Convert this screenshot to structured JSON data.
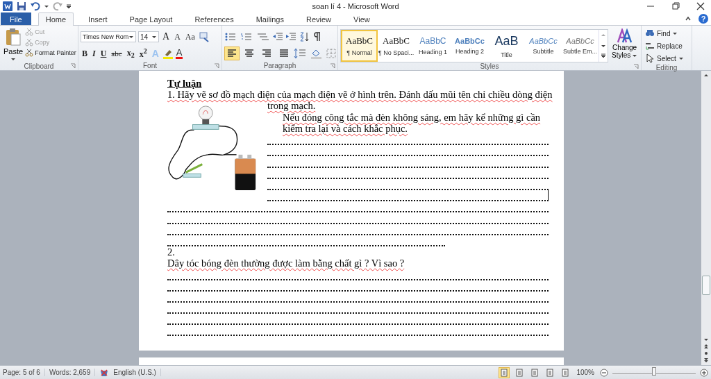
{
  "window": {
    "title": "soan lí 4 - Microsoft Word"
  },
  "tabs": [
    {
      "label": "File",
      "kind": "file",
      "selected": false
    },
    {
      "label": "Home",
      "kind": "tab",
      "selected": true
    },
    {
      "label": "Insert",
      "kind": "tab",
      "selected": false
    },
    {
      "label": "Page Layout",
      "kind": "tab",
      "selected": false
    },
    {
      "label": "References",
      "kind": "tab",
      "selected": false
    },
    {
      "label": "Mailings",
      "kind": "tab",
      "selected": false
    },
    {
      "label": "Review",
      "kind": "tab",
      "selected": false
    },
    {
      "label": "View",
      "kind": "tab",
      "selected": false
    }
  ],
  "help": "?",
  "clipboard": {
    "label": "Clipboard",
    "paste": "Paste",
    "items": [
      {
        "label": "Cut",
        "disabled": true
      },
      {
        "label": "Copy",
        "disabled": true
      },
      {
        "label": "Format Painter",
        "disabled": false
      }
    ]
  },
  "font": {
    "label": "Font",
    "name": "Times New Rom",
    "size": "14",
    "row1": [
      "A",
      "A",
      "Aa"
    ],
    "row2": [
      "B",
      "I",
      "U",
      "abc",
      "x$_{2}$",
      "x$^{2}$"
    ],
    "row2b": [
      "A",
      "A"
    ]
  },
  "paragraph": {
    "label": "Paragraph",
    "alignments": [
      {
        "selected": true
      },
      {
        "selected": false
      },
      {
        "selected": false
      },
      {
        "selected": false
      }
    ]
  },
  "styles": {
    "label": "Styles",
    "items": [
      {
        "preview": "AaBbC",
        "name": "¶ Normal",
        "kind": "normal",
        "selected": true
      },
      {
        "preview": "AaBbC",
        "name": "¶ No Spaci...",
        "kind": "normal",
        "selected": false
      },
      {
        "preview": "AaBbC",
        "name": "Heading 1",
        "kind": "heading1",
        "selected": false
      },
      {
        "preview": "AaBbCc",
        "name": "Heading 2",
        "kind": "heading2",
        "selected": false
      },
      {
        "preview": "AaB",
        "name": "Title",
        "kind": "title",
        "selected": false
      },
      {
        "preview": "AaBbCc",
        "name": "Subtitle",
        "kind": "subtitle",
        "selected": false
      },
      {
        "preview": "AaBbCc",
        "name": "Subtle Em...",
        "kind": "emphasis",
        "selected": false
      }
    ],
    "change": [
      "Change",
      "Styles"
    ]
  },
  "editing": {
    "label": "Editing",
    "items": [
      {
        "label": "Find",
        "dropdown": true
      },
      {
        "label": "Replace",
        "dropdown": false
      },
      {
        "label": "Select",
        "dropdown": true
      }
    ]
  },
  "document": {
    "heading": "Tự luận",
    "q1": "1. Hãy vẽ sơ đồ mạch điện của mạch điện vẽ ở hình trên. Đánh dấu mũi tên chỉ chiều dòng điện",
    "q1_cont": "trong mạch.",
    "q1b": [
      "Nếu đóng công tắc mà đèn không sáng, em hãy kể những gì cần",
      "kiểm tra lại và cách khắc phục."
    ],
    "figure_lines": [
      {
        "kind": "full"
      },
      {
        "kind": "full"
      },
      {
        "kind": "full"
      },
      {
        "kind": "full"
      },
      {
        "kind": "full"
      },
      {
        "kind": "cursor"
      }
    ],
    "lines_after": [
      {
        "kind": "full"
      },
      {
        "kind": "full"
      },
      {
        "kind": "full"
      },
      {
        "kind": "partial"
      }
    ],
    "q2_number": "2.",
    "q2": "Dây tóc bóng đèn thường được làm bằng chất gì ? Vì sao ?",
    "q2_lines": [
      {
        "kind": "full"
      },
      {
        "kind": "full"
      },
      {
        "kind": "full"
      },
      {
        "kind": "full"
      },
      {
        "kind": "full"
      },
      {
        "kind": "full"
      }
    ]
  },
  "status_bar": {
    "page": "Page: 5 of 6",
    "words": "Words: 2,659",
    "language": "English (U.S.)",
    "views": [
      {
        "selected": true
      },
      {
        "selected": false
      },
      {
        "selected": false
      },
      {
        "selected": false
      },
      {
        "selected": false
      }
    ],
    "zoom": "100%",
    "zoom_level": {
      "level": 0.5
    }
  }
}
